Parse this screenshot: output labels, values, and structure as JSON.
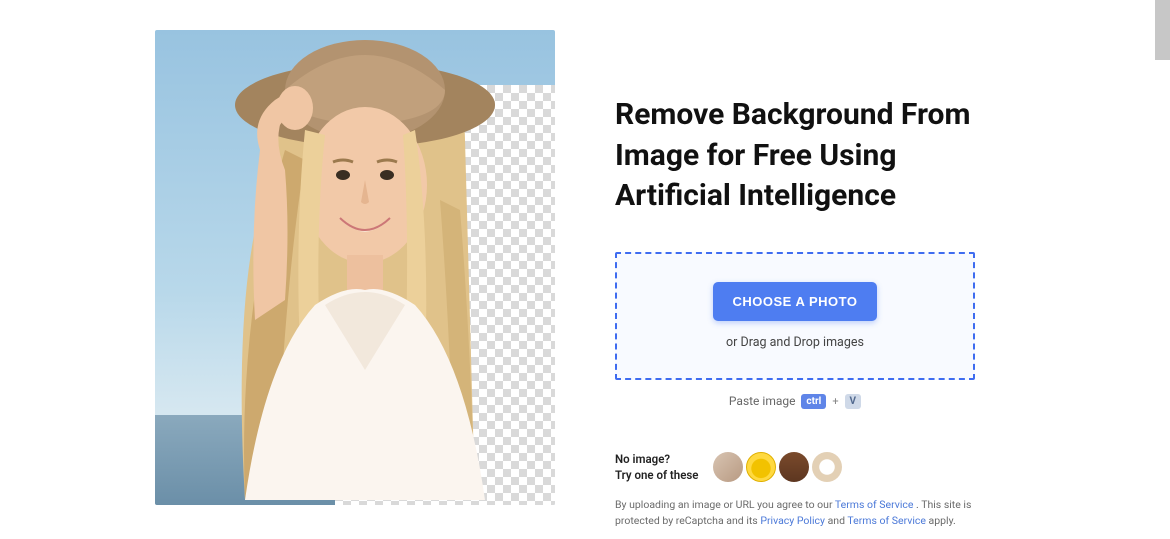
{
  "headline": "Remove Background From Image for Free Using Artificial Intelligence",
  "dropzone": {
    "choose_label": "CHOOSE A PHOTO",
    "drag_label": "or Drag and Drop images"
  },
  "paste": {
    "label": "Paste image",
    "key1": "ctrl",
    "plus": "+",
    "key2": "V"
  },
  "noimage": {
    "line1": "No image?",
    "line2": "Try one of these"
  },
  "legal": {
    "prefix": "By uploading an image or URL you agree to our ",
    "tos": "Terms of Service",
    "mid1": " . This site is protected by reCaptcha and its ",
    "privacy": "Privacy Policy",
    "and": " and ",
    "tos2": "Terms of Service",
    "suffix": " apply."
  }
}
